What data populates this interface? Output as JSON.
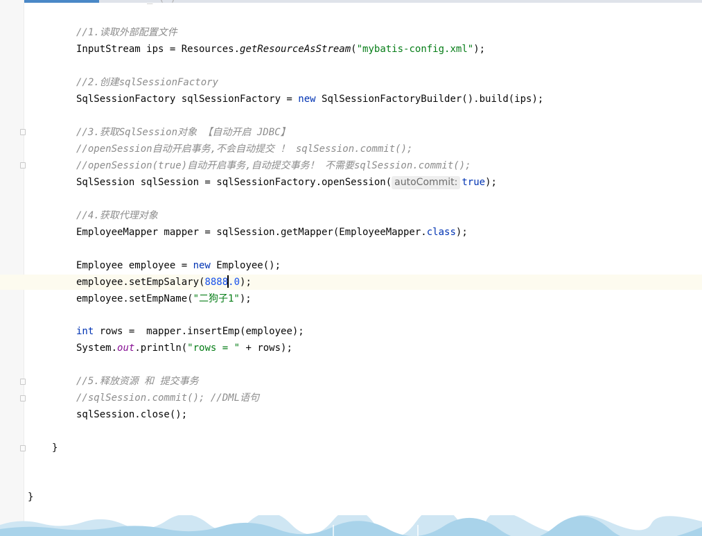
{
  "top_partial": "_ ( )",
  "code": {
    "c1": "//1.读取外部配置文件",
    "l1_type": "InputStream ips = Resources.",
    "l1_method": "getResourceAsStream",
    "l1_str": "\"mybatis-config.xml\"",
    "l1_end": ");",
    "c2": "//2.创建sqlSessionFactory",
    "l2_a": "SqlSessionFactory sqlSessionFactory = ",
    "l2_kw": "new",
    "l2_b": " SqlSessionFactoryBuilder().build(ips);",
    "c3": "//3.获取SqlSession对象 【自动开启 JDBC】",
    "c4": "//openSession自动开启事务,不会自动提交 ！ sqlSession.commit();",
    "c5": "//openSession(true)自动开启事务,自动提交事务！ 不需要sqlSession.commit();",
    "l3_a": "SqlSession sqlSession = sqlSessionFactory.openSession(",
    "l3_hint": "autoCommit:",
    "l3_kw": "true",
    "l3_end": ");",
    "c6": "//4.获取代理对象",
    "l4_a": "EmployeeMapper mapper = sqlSession.getMapper(EmployeeMapper.",
    "l4_kw": "class",
    "l4_end": ");",
    "l5_a": "Employee employee = ",
    "l5_kw": "new",
    "l5_b": " Employee();",
    "l6_a": "employee.setEmpSalary(",
    "l6_num_a": "8888",
    "l6_num_b": ".0",
    "l6_end": ");",
    "l7_a": "employee.setEmpName(",
    "l7_str": "\"二狗子1\"",
    "l7_end": ");",
    "l8_kw": "int",
    "l8_b": " rows =  mapper.insertEmp(employee);",
    "l9_a": "System.",
    "l9_field": "out",
    "l9_b": ".println(",
    "l9_str": "\"rows = \"",
    "l9_end": " + rows);",
    "c7": "//5.释放资源 和 提交事务",
    "c8": "//sqlSession.commit(); //DML语句",
    "l10": "sqlSession.close();",
    "brace_method": "}",
    "brace_class": "}"
  }
}
